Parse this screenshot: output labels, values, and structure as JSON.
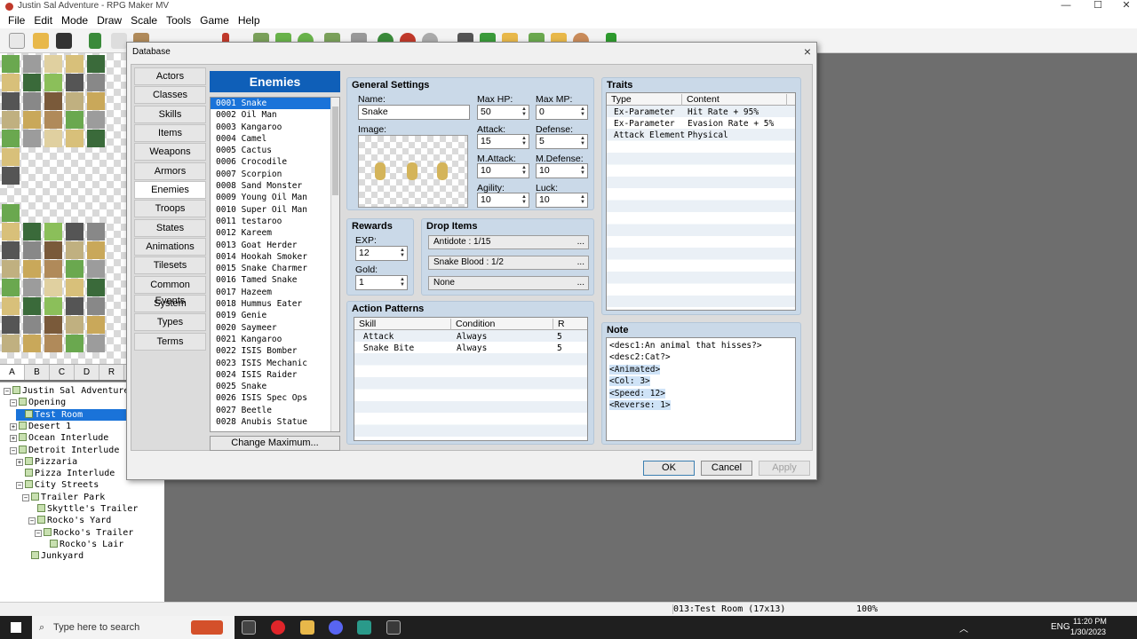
{
  "window": {
    "title": "Justin Sal Adventure - RPG Maker MV"
  },
  "menu": [
    "File",
    "Edit",
    "Mode",
    "Draw",
    "Scale",
    "Tools",
    "Game",
    "Help"
  ],
  "tile_tabs": [
    "A",
    "B",
    "C",
    "D",
    "R"
  ],
  "map_tree": [
    {
      "label": "Justin Sal Adventure",
      "indent": 0,
      "expand": "−"
    },
    {
      "label": "Opening",
      "indent": 1,
      "expand": "−"
    },
    {
      "label": "Test Room",
      "indent": 2,
      "expand": "",
      "selected": true
    },
    {
      "label": "Desert 1",
      "indent": 1,
      "expand": "+"
    },
    {
      "label": "Ocean Interlude",
      "indent": 1,
      "expand": "+"
    },
    {
      "label": "Detroit Interlude",
      "indent": 1,
      "expand": "−"
    },
    {
      "label": "Pizzaria",
      "indent": 2,
      "expand": "+"
    },
    {
      "label": "Pizza Interlude",
      "indent": 2,
      "expand": ""
    },
    {
      "label": "City Streets",
      "indent": 2,
      "expand": "−"
    },
    {
      "label": "Trailer Park",
      "indent": 3,
      "expand": "−"
    },
    {
      "label": "Skyttle's Trailer",
      "indent": 4,
      "expand": ""
    },
    {
      "label": "Rocko's Yard",
      "indent": 4,
      "expand": "−"
    },
    {
      "label": "Rocko's Trailer",
      "indent": 5,
      "expand": "−"
    },
    {
      "label": "Rocko's Lair",
      "indent": 6,
      "expand": ""
    },
    {
      "label": "Junkyard",
      "indent": 3,
      "expand": ""
    }
  ],
  "dialog": {
    "title": "Database",
    "close": "×"
  },
  "categories": [
    "Actors",
    "Classes",
    "Skills",
    "Items",
    "Weapons",
    "Armors",
    "Enemies",
    "Troops",
    "States",
    "Animations",
    "Tilesets",
    "Common Events",
    "System",
    "Types",
    "Terms"
  ],
  "selected_category": "Enemies",
  "enemies_title": "Enemies",
  "enemies": [
    "0001 Snake",
    "0002 Oil Man",
    "0003 Kangaroo",
    "0004 Camel",
    "0005 Cactus",
    "0006 Crocodile",
    "0007 Scorpion",
    "0008 Sand Monster",
    "0009 Young Oil Man",
    "0010 Super Oil Man",
    "0011 testaroo",
    "0012 Kareem",
    "0013 Goat Herder",
    "0014 Hookah Smoker",
    "0015 Snake Charmer",
    "0016 Tamed Snake",
    "0017 Hazeem",
    "0018 Hummus Eater",
    "0019 Genie",
    "0020 Saymeer",
    "0021 Kangaroo",
    "0022 ISIS Bomber",
    "0023 ISIS Mechanic",
    "0024 ISIS Raider",
    "0025 Snake",
    "0026 ISIS Spec Ops",
    "0027 Beetle",
    "0028 Anubis Statue"
  ],
  "change_max": "Change Maximum...",
  "general": {
    "title": "General Settings",
    "name_label": "Name:",
    "name": "Snake",
    "image_label": "Image:",
    "maxhp_label": "Max HP:",
    "maxhp": "50",
    "maxmp_label": "Max MP:",
    "maxmp": "0",
    "attack_label": "Attack:",
    "attack": "15",
    "defense_label": "Defense:",
    "defense": "5",
    "mattack_label": "M.Attack:",
    "mattack": "10",
    "mdefense_label": "M.Defense:",
    "mdefense": "10",
    "agility_label": "Agility:",
    "agility": "10",
    "luck_label": "Luck:",
    "luck": "10"
  },
  "rewards": {
    "title": "Rewards",
    "exp_label": "EXP:",
    "exp": "12",
    "gold_label": "Gold:",
    "gold": "1"
  },
  "drops": {
    "title": "Drop Items",
    "items": [
      "Antidote : 1/15",
      "Snake Blood : 1/2",
      "None"
    ],
    "more": "..."
  },
  "actions": {
    "title": "Action Patterns",
    "headers": [
      "Skill",
      "Condition",
      "R"
    ],
    "rows": [
      [
        "Attack",
        "Always",
        "5"
      ],
      [
        "Snake Bite",
        "Always",
        "5"
      ]
    ]
  },
  "traits": {
    "title": "Traits",
    "headers": [
      "Type",
      "Content"
    ],
    "rows": [
      [
        "Ex-Parameter",
        "Hit Rate + 95%"
      ],
      [
        "Ex-Parameter",
        "Evasion Rate + 5%"
      ],
      [
        "Attack Element",
        "Physical"
      ]
    ]
  },
  "note": {
    "title": "Note",
    "lines": [
      "<desc1:An animal that hisses?>",
      "<desc2:Cat?>",
      "<Animated>",
      "<Col: 3>",
      "<Speed: 12>",
      "<Reverse: 1>"
    ]
  },
  "buttons": {
    "ok": "OK",
    "cancel": "Cancel",
    "apply": "Apply"
  },
  "status": {
    "map": "013:Test Room (17x13)",
    "zoom": "100%"
  },
  "taskbar": {
    "search": "Type here to search",
    "lang": "ENG",
    "time": "11:20 PM",
    "date": "1/30/2023"
  }
}
